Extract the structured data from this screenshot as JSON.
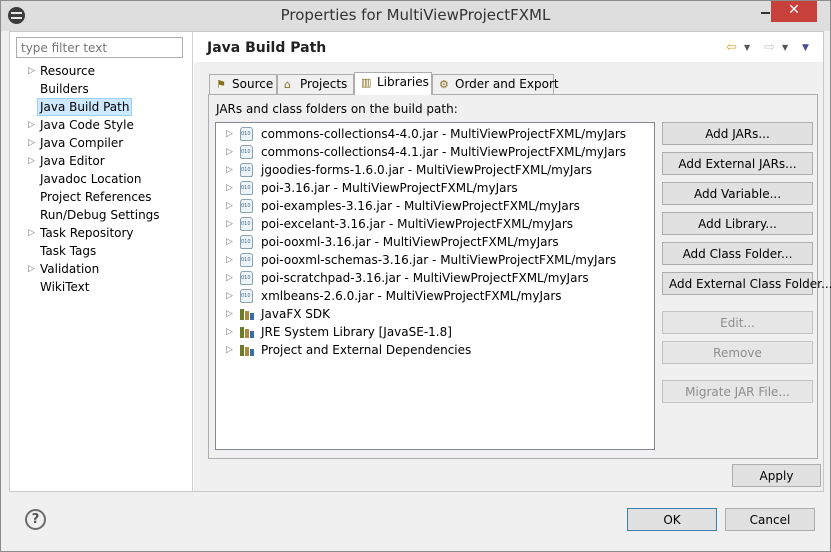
{
  "window": {
    "title": "Properties for MultiViewProjectFXML"
  },
  "controls": {
    "minimize": "minimize",
    "maximize": "maximize",
    "close": "✕"
  },
  "sidebar": {
    "filter_placeholder": "type filter text",
    "items": [
      {
        "label": "Resource",
        "expandable": true
      },
      {
        "label": "Builders",
        "expandable": false
      },
      {
        "label": "Java Build Path",
        "expandable": false,
        "selected": true
      },
      {
        "label": "Java Code Style",
        "expandable": true
      },
      {
        "label": "Java Compiler",
        "expandable": true
      },
      {
        "label": "Java Editor",
        "expandable": true
      },
      {
        "label": "Javadoc Location",
        "expandable": false
      },
      {
        "label": "Project References",
        "expandable": false
      },
      {
        "label": "Run/Debug Settings",
        "expandable": false
      },
      {
        "label": "Task Repository",
        "expandable": true
      },
      {
        "label": "Task Tags",
        "expandable": false
      },
      {
        "label": "Validation",
        "expandable": true
      },
      {
        "label": "WikiText",
        "expandable": false
      }
    ]
  },
  "page": {
    "title": "Java Build Path",
    "tabs": [
      {
        "label": "Source",
        "icon": "source-folder-icon"
      },
      {
        "label": "Projects",
        "icon": "projects-icon"
      },
      {
        "label": "Libraries",
        "icon": "libraries-icon",
        "active": true
      },
      {
        "label": "Order and Export",
        "icon": "order-export-icon"
      }
    ],
    "caption": "JARs and class folders on the build path:",
    "entries": [
      {
        "label": "commons-collections4-4.0.jar - MultiViewProjectFXML/myJars",
        "icon": "jar-icon"
      },
      {
        "label": "commons-collections4-4.1.jar - MultiViewProjectFXML/myJars",
        "icon": "jar-icon"
      },
      {
        "label": "jgoodies-forms-1.6.0.jar - MultiViewProjectFXML/myJars",
        "icon": "jar-icon"
      },
      {
        "label": "poi-3.16.jar - MultiViewProjectFXML/myJars",
        "icon": "jar-icon"
      },
      {
        "label": "poi-examples-3.16.jar - MultiViewProjectFXML/myJars",
        "icon": "jar-icon"
      },
      {
        "label": "poi-excelant-3.16.jar - MultiViewProjectFXML/myJars",
        "icon": "jar-icon"
      },
      {
        "label": "poi-ooxml-3.16.jar - MultiViewProjectFXML/myJars",
        "icon": "jar-icon"
      },
      {
        "label": "poi-ooxml-schemas-3.16.jar - MultiViewProjectFXML/myJars",
        "icon": "jar-icon"
      },
      {
        "label": "poi-scratchpad-3.16.jar - MultiViewProjectFXML/myJars",
        "icon": "jar-icon"
      },
      {
        "label": "xmlbeans-2.6.0.jar - MultiViewProjectFXML/myJars",
        "icon": "jar-icon"
      },
      {
        "label": "JavaFX SDK",
        "icon": "library-icon"
      },
      {
        "label": "JRE System Library [JavaSE-1.8]",
        "icon": "library-icon"
      },
      {
        "label": "Project and External Dependencies",
        "icon": "library-icon"
      }
    ],
    "buttons": [
      {
        "label": "Add JARs...",
        "enabled": true
      },
      {
        "label": "Add External JARs...",
        "enabled": true
      },
      {
        "label": "Add Variable...",
        "enabled": true
      },
      {
        "label": "Add Library...",
        "enabled": true
      },
      {
        "label": "Add Class Folder...",
        "enabled": true
      },
      {
        "label": "Add External Class Folder...",
        "enabled": true
      },
      {
        "label": "Edit...",
        "enabled": false
      },
      {
        "label": "Remove",
        "enabled": false
      },
      {
        "label": "Migrate JAR File...",
        "enabled": false
      }
    ],
    "apply": "Apply"
  },
  "footer": {
    "help": "?",
    "ok": "OK",
    "cancel": "Cancel"
  },
  "colors": {
    "selection": "#cde8ff",
    "close_button": "#c7413a",
    "ok_border": "#3c7fb1"
  }
}
